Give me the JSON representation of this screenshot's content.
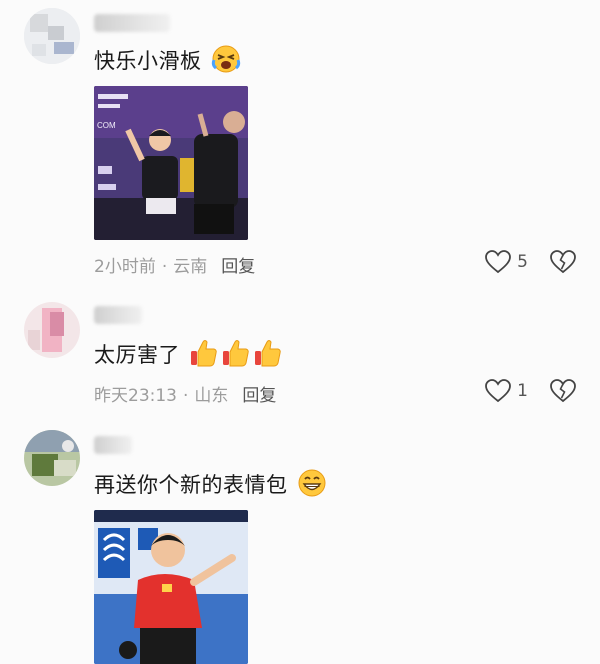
{
  "comments": [
    {
      "text": "快乐小滑板",
      "time": "2小时前",
      "location": "云南",
      "reply_label": "回复",
      "likes": "5",
      "emoji": "laughing-tears-emoji",
      "has_photo": true,
      "photo_caption": "COM"
    },
    {
      "text": "太厉害了",
      "time": "昨天23:13",
      "location": "山东",
      "reply_label": "回复",
      "likes": "1",
      "emoji": "thumbs-up-emoji"
    },
    {
      "text": "再送你个新的表情包",
      "emoji": "grin-emoji",
      "has_photo": true
    }
  ],
  "separator": "·",
  "colors": {
    "background": "#fbfbfb",
    "meta_text": "#9c9c9c",
    "body_text": "#1a1a1a"
  }
}
